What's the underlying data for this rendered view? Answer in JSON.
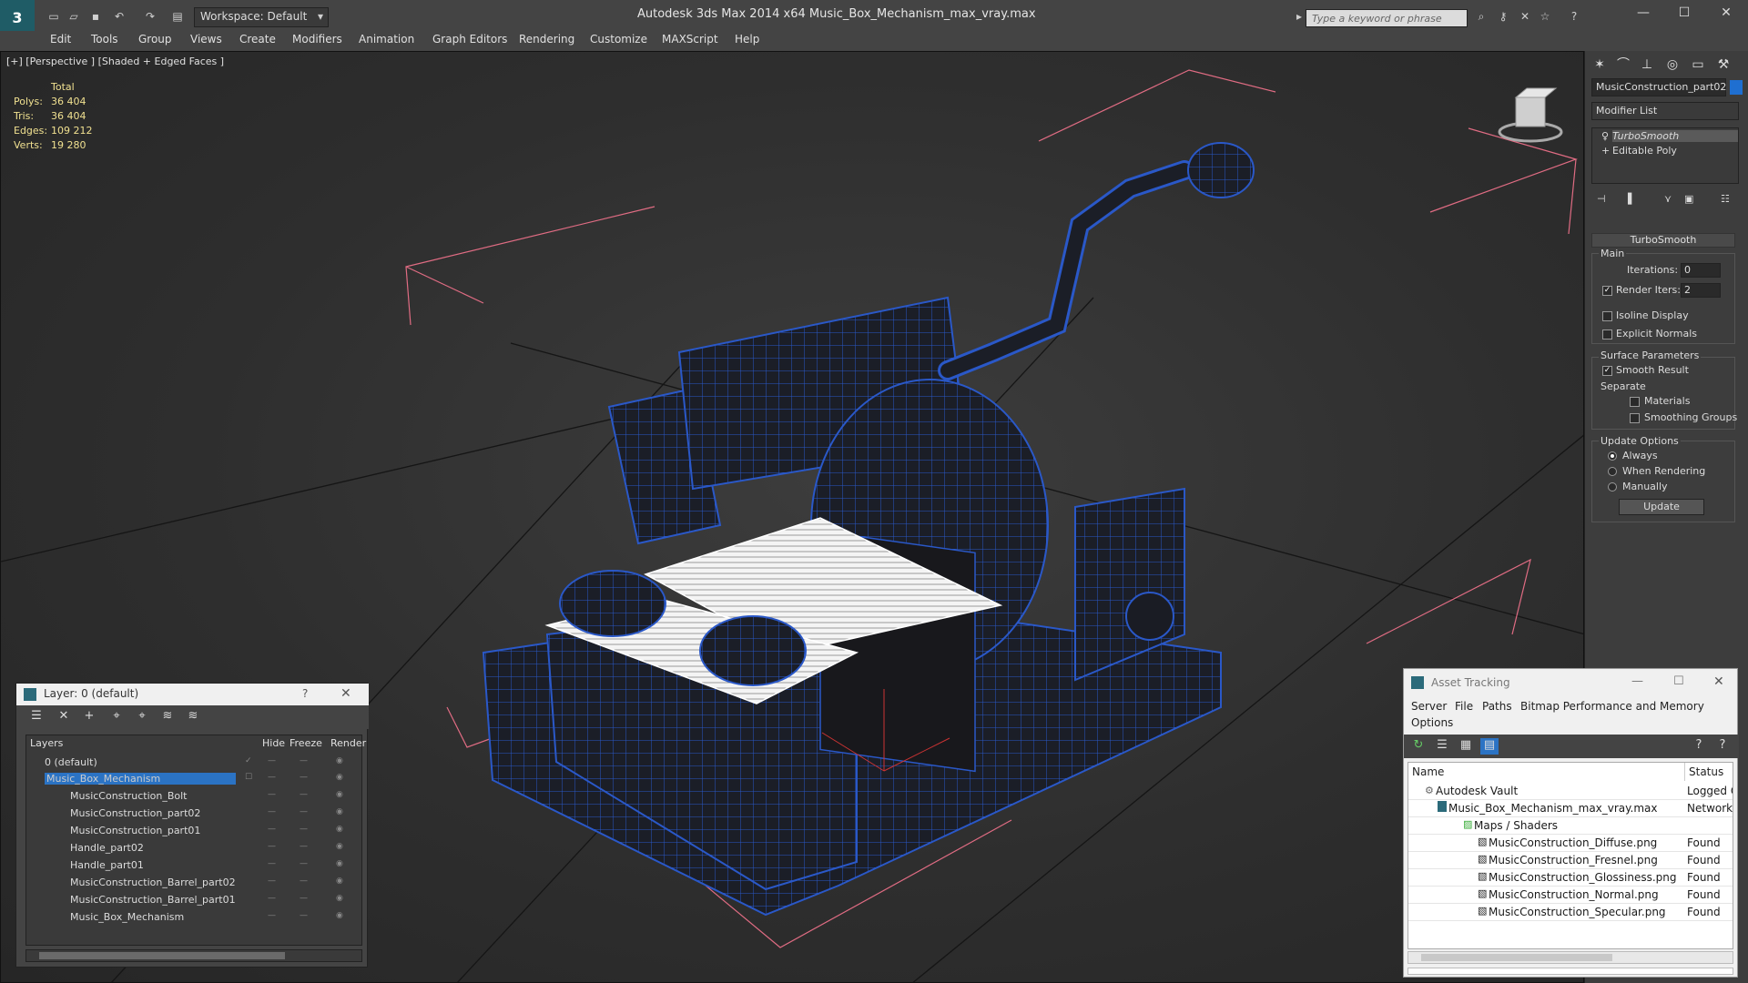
{
  "title_bar": {
    "workspace": "Workspace: Default",
    "app_title": "Autodesk 3ds Max  2014 x64      Music_Box_Mechanism_max_vray.max",
    "search_placeholder": "Type a keyword or phrase"
  },
  "menubar": [
    "Edit",
    "Tools",
    "Group",
    "Views",
    "Create",
    "Modifiers",
    "Animation",
    "Graph Editors",
    "Rendering",
    "Customize",
    "MAXScript",
    "Help"
  ],
  "viewport": {
    "label": "[+] [Perspective ] [Shaded + Edged Faces ]",
    "stats": {
      "header": "Total",
      "rows": [
        {
          "label": "Polys:",
          "value": "36 404"
        },
        {
          "label": "Tris:",
          "value": "36 404"
        },
        {
          "label": "Edges:",
          "value": "109 212"
        },
        {
          "label": "Verts:",
          "value": "19 280"
        }
      ]
    }
  },
  "command_panel": {
    "object_name": "MusicConstruction_part02",
    "object_color": "#1f6fd1",
    "modifier_list": "Modifier List",
    "stack": [
      "TurboSmooth",
      "Editable Poly"
    ],
    "rollout": "TurboSmooth",
    "main_label": "Main",
    "iterations_label": "Iterations:",
    "iterations_value": "0",
    "render_iters_label": "Render Iters:",
    "render_iters_value": "2",
    "isoline": "Isoline Display",
    "explicit": "Explicit Normals",
    "surface_label": "Surface Parameters",
    "smooth_result": "Smooth Result",
    "separate": "Separate",
    "materials": "Materials",
    "smoothing_groups": "Smoothing Groups",
    "update_options": "Update Options",
    "always": "Always",
    "when_rendering": "When Rendering",
    "manually": "Manually",
    "update_button": "Update"
  },
  "layer_window": {
    "title": "Layer: 0 (default)",
    "help": "?",
    "headers": {
      "layers": "Layers",
      "hide": "Hide",
      "freeze": "Freeze",
      "render": "Render"
    },
    "rows": [
      {
        "name": "0 (default)",
        "indent": 0
      },
      {
        "name": "Music_Box_Mechanism",
        "indent": 0
      },
      {
        "name": "MusicConstruction_Bolt",
        "indent": 1
      },
      {
        "name": "MusicConstruction_part02",
        "indent": 1
      },
      {
        "name": "MusicConstruction_part01",
        "indent": 1
      },
      {
        "name": "Handle_part02",
        "indent": 1
      },
      {
        "name": "Handle_part01",
        "indent": 1
      },
      {
        "name": "MusicConstruction_Barrel_part02",
        "indent": 1
      },
      {
        "name": "MusicConstruction_Barrel_part01",
        "indent": 1
      },
      {
        "name": "Music_Box_Mechanism",
        "indent": 1
      }
    ]
  },
  "asset_window": {
    "title": "Asset Tracking",
    "menu": [
      "Server",
      "File",
      "Paths",
      "Bitmap Performance and Memory",
      "Options"
    ],
    "headers": {
      "name": "Name",
      "status": "Status"
    },
    "rows": [
      {
        "name": "Autodesk Vault",
        "status": "Logged O"
      },
      {
        "name": "Music_Box_Mechanism_max_vray.max",
        "status": "Network"
      },
      {
        "name": "Maps / Shaders",
        "status": ""
      },
      {
        "name": "MusicConstruction_Diffuse.png",
        "status": "Found"
      },
      {
        "name": "MusicConstruction_Fresnel.png",
        "status": "Found"
      },
      {
        "name": "MusicConstruction_Glossiness.png",
        "status": "Found"
      },
      {
        "name": "MusicConstruction_Normal.png",
        "status": "Found"
      },
      {
        "name": "MusicConstruction_Specular.png",
        "status": "Found"
      }
    ]
  }
}
